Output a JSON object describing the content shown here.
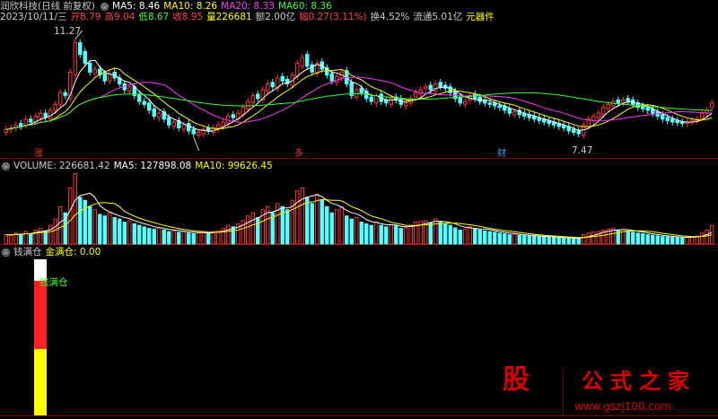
{
  "header": {
    "title": "润欣科技(日线 前复权)",
    "ma_items": [
      {
        "label": "MA5: 8.46",
        "color": "#ffffff"
      },
      {
        "label": "MA10: 8.26",
        "color": "#ffff00"
      },
      {
        "label": "MA20: 8.33",
        "color": "#ff33ff"
      },
      {
        "label": "MA60: 8.36",
        "color": "#33ff33"
      }
    ],
    "quote_items": [
      {
        "label": "2023/10/11/三",
        "color": "#cccccc"
      },
      {
        "label": "开8.79",
        "color": "#ff4040"
      },
      {
        "label": "高9.04",
        "color": "#ff4040"
      },
      {
        "label": "低8.67",
        "color": "#40ff40"
      },
      {
        "label": "收8.95",
        "color": "#ff4040"
      },
      {
        "label": "量226681",
        "color": "#ffff00"
      },
      {
        "label": "额2.00亿",
        "color": "#cccccc"
      },
      {
        "label": "幅0.27(3.11%)",
        "color": "#ff4040"
      },
      {
        "label": "换4.52%",
        "color": "#cccccc"
      },
      {
        "label": "流通5.01亿",
        "color": "#cccccc"
      },
      {
        "label": "元器件",
        "color": "#ffff00"
      }
    ]
  },
  "volume_header": [
    {
      "label": "VOLUME: 226681.42",
      "color": "#cccccc"
    },
    {
      "label": "MA5: 127898.08",
      "color": "#ffffff"
    },
    {
      "label": "MA10: 99626.45",
      "color": "#ffff00"
    }
  ],
  "indicator_header": [
    {
      "label": "钱满仓",
      "color": "#cccccc"
    },
    {
      "label": "金满仓: 0.00",
      "color": "#ffff00"
    }
  ],
  "annotations": {
    "high_label": "11.27",
    "low_label": "7.47",
    "markers": [
      {
        "text": "涨",
        "color": "#ff3030"
      },
      {
        "text": "多",
        "color": "#ff3030"
      },
      {
        "text": "财",
        "color": "#40a0ff"
      }
    ],
    "indicator_label": "钱满仓"
  },
  "colors": {
    "up": "#ff3232",
    "down": "#54ffff",
    "ma5": "#ffffff",
    "ma10": "#ffff00",
    "ma20": "#ff33ff",
    "ma60": "#33ff33",
    "grid": "#800000"
  },
  "watermark": {
    "logo": "股",
    "brand": "公式之家",
    "url": "www.gszj100.com"
  },
  "chart_data": [
    {
      "type": "candlestick",
      "ylim": [
        7.2,
        11.6
      ],
      "closes": [
        8.05,
        8.1,
        8.2,
        8.15,
        8.4,
        8.3,
        8.5,
        8.6,
        8.45,
        8.7,
        8.9,
        9.3,
        9.2,
        10.0,
        11.0,
        10.6,
        10.3,
        10.0,
        10.1,
        9.9,
        9.7,
        9.95,
        9.8,
        9.6,
        9.4,
        9.5,
        9.2,
        9.0,
        8.9,
        8.7,
        8.5,
        8.6,
        8.4,
        8.2,
        8.3,
        8.1,
        8.2,
        8.0,
        7.9,
        7.95,
        8.05,
        8.0,
        8.1,
        8.2,
        8.3,
        8.5,
        8.45,
        8.6,
        8.8,
        9.0,
        9.2,
        9.1,
        9.4,
        9.6,
        9.5,
        9.8,
        9.7,
        9.6,
        9.9,
        10.3,
        10.5,
        10.2,
        10.0,
        10.3,
        10.1,
        9.9,
        9.7,
        9.85,
        10.0,
        9.6,
        9.2,
        9.4,
        9.3,
        9.1,
        9.0,
        9.2,
        9.0,
        8.95,
        9.1,
        9.05,
        8.9,
        8.95,
        9.1,
        9.3,
        9.4,
        9.5,
        9.4,
        9.6,
        9.5,
        9.45,
        9.3,
        9.1,
        8.95,
        9.0,
        9.2,
        9.1,
        9.0,
        8.95,
        8.9,
        8.85,
        8.8,
        8.7,
        8.6,
        8.65,
        8.55,
        8.5,
        8.45,
        8.4,
        8.35,
        8.3,
        8.25,
        8.2,
        8.15,
        8.1,
        8.0,
        7.95,
        7.9,
        8.2,
        8.4,
        8.5,
        8.6,
        8.8,
        8.9,
        9.0,
        8.95,
        9.05,
        9.0,
        8.9,
        8.8,
        8.75,
        8.7,
        8.6,
        8.5,
        8.4,
        8.35,
        8.3,
        8.28,
        8.25,
        8.3,
        8.35,
        8.4,
        8.6,
        8.7,
        8.95
      ],
      "opens": [
        7.95,
        8.05,
        8.1,
        8.25,
        8.2,
        8.4,
        8.3,
        8.45,
        8.6,
        8.4,
        8.7,
        8.9,
        9.3,
        9.1,
        9.9,
        11.0,
        10.7,
        10.3,
        9.95,
        10.1,
        9.95,
        9.7,
        10.0,
        9.8,
        9.6,
        9.35,
        9.5,
        9.25,
        9.0,
        8.95,
        8.75,
        8.45,
        8.65,
        8.45,
        8.15,
        8.35,
        8.05,
        8.25,
        8.05,
        7.85,
        7.9,
        8.1,
        7.95,
        8.05,
        8.15,
        8.25,
        8.55,
        8.4,
        8.55,
        8.75,
        8.95,
        9.25,
        9.05,
        9.35,
        9.65,
        9.45,
        9.85,
        9.75,
        9.55,
        9.85,
        10.2,
        10.6,
        10.25,
        9.95,
        10.35,
        10.15,
        9.95,
        9.65,
        9.8,
        10.05,
        9.65,
        9.15,
        9.45,
        9.35,
        9.15,
        8.95,
        9.25,
        9.05,
        8.9,
        9.15,
        9.1,
        8.85,
        8.95,
        9.15,
        9.25,
        9.45,
        9.55,
        9.35,
        9.65,
        9.55,
        9.5,
        9.35,
        9.15,
        8.9,
        9.05,
        9.25,
        9.15,
        9.05,
        8.95,
        8.95,
        8.85,
        8.85,
        8.75,
        8.55,
        8.7,
        8.6,
        8.55,
        8.5,
        8.45,
        8.4,
        8.35,
        8.3,
        8.25,
        8.2,
        8.15,
        8.05,
        8.0,
        7.85,
        8.15,
        8.35,
        8.45,
        8.55,
        8.75,
        8.85,
        9.05,
        8.95,
        9.1,
        9.05,
        8.95,
        8.85,
        8.8,
        8.75,
        8.65,
        8.55,
        8.45,
        8.4,
        8.35,
        8.3,
        8.25,
        8.3,
        8.35,
        8.45,
        8.6,
        8.79
      ],
      "series": [
        {
          "name": "MA5",
          "color": "#ffffff"
        },
        {
          "name": "MA10",
          "color": "#ffff00"
        },
        {
          "name": "MA20",
          "color": "#ff33ff"
        },
        {
          "name": "MA60",
          "color": "#33ff33"
        }
      ]
    },
    {
      "type": "bar",
      "ylim": [
        0,
        230000
      ],
      "values": [
        30000,
        28000,
        35000,
        32000,
        40000,
        33000,
        45000,
        50000,
        42000,
        60000,
        80000,
        120000,
        100000,
        180000,
        226000,
        150000,
        140000,
        120000,
        110000,
        95000,
        90000,
        100000,
        85000,
        80000,
        70000,
        75000,
        65000,
        60000,
        55000,
        50000,
        48000,
        52000,
        45000,
        40000,
        42000,
        38000,
        40000,
        35000,
        33000,
        36000,
        38000,
        35000,
        40000,
        42000,
        50000,
        60000,
        55000,
        65000,
        75000,
        90000,
        100000,
        85000,
        110000,
        120000,
        100000,
        130000,
        120000,
        110000,
        140000,
        170000,
        180000,
        150000,
        130000,
        160000,
        140000,
        120000,
        100000,
        110000,
        120000,
        90000,
        80000,
        85000,
        70000,
        65000,
        60000,
        70000,
        60000,
        55000,
        62000,
        58000,
        50000,
        52000,
        60000,
        70000,
        72000,
        75000,
        68000,
        80000,
        70000,
        65000,
        60000,
        52000,
        45000,
        48000,
        55000,
        50000,
        45000,
        42000,
        40000,
        38000,
        35000,
        33000,
        30000,
        32000,
        28000,
        27000,
        26000,
        25000,
        24000,
        23000,
        22000,
        21000,
        20000,
        20000,
        19000,
        18000,
        17000,
        30000,
        35000,
        38000,
        40000,
        45000,
        48000,
        50000,
        44000,
        46000,
        42000,
        38000,
        35000,
        33000,
        30000,
        28000,
        26000,
        24000,
        23000,
        22000,
        21000,
        20000,
        22000,
        24000,
        26000,
        35000,
        45000,
        60000
      ]
    }
  ]
}
